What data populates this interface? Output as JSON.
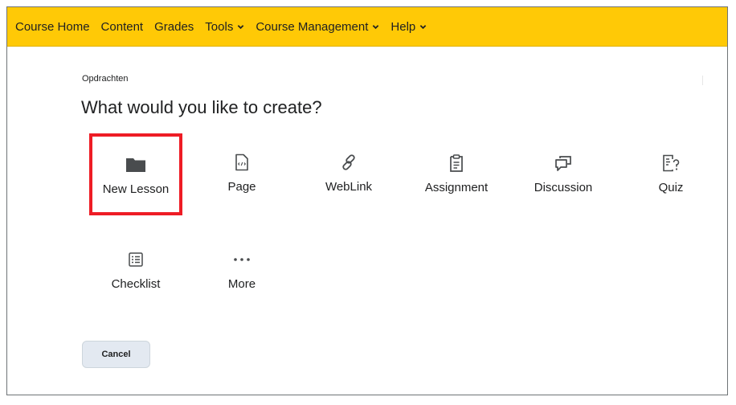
{
  "nav": {
    "items": [
      {
        "label": "Course Home",
        "dropdown": false
      },
      {
        "label": "Content",
        "dropdown": false
      },
      {
        "label": "Grades",
        "dropdown": false
      },
      {
        "label": "Tools",
        "dropdown": true
      },
      {
        "label": "Course Management",
        "dropdown": true
      },
      {
        "label": "Help",
        "dropdown": true
      }
    ],
    "background_color": "#ffc906"
  },
  "breadcrumb": "Opdrachten",
  "title": "What would you like to create?",
  "options": [
    {
      "label": "New Lesson",
      "icon": "folder-icon",
      "highlighted": true
    },
    {
      "label": "Page",
      "icon": "html-page-icon"
    },
    {
      "label": "WebLink",
      "icon": "link-icon"
    },
    {
      "label": "Assignment",
      "icon": "assignment-icon"
    },
    {
      "label": "Discussion",
      "icon": "discussion-icon"
    },
    {
      "label": "Quiz",
      "icon": "quiz-icon"
    },
    {
      "label": "Checklist",
      "icon": "checklist-icon"
    },
    {
      "label": "More",
      "icon": "more-icon"
    }
  ],
  "cancel_label": "Cancel",
  "highlight_color": "#ee1c25"
}
